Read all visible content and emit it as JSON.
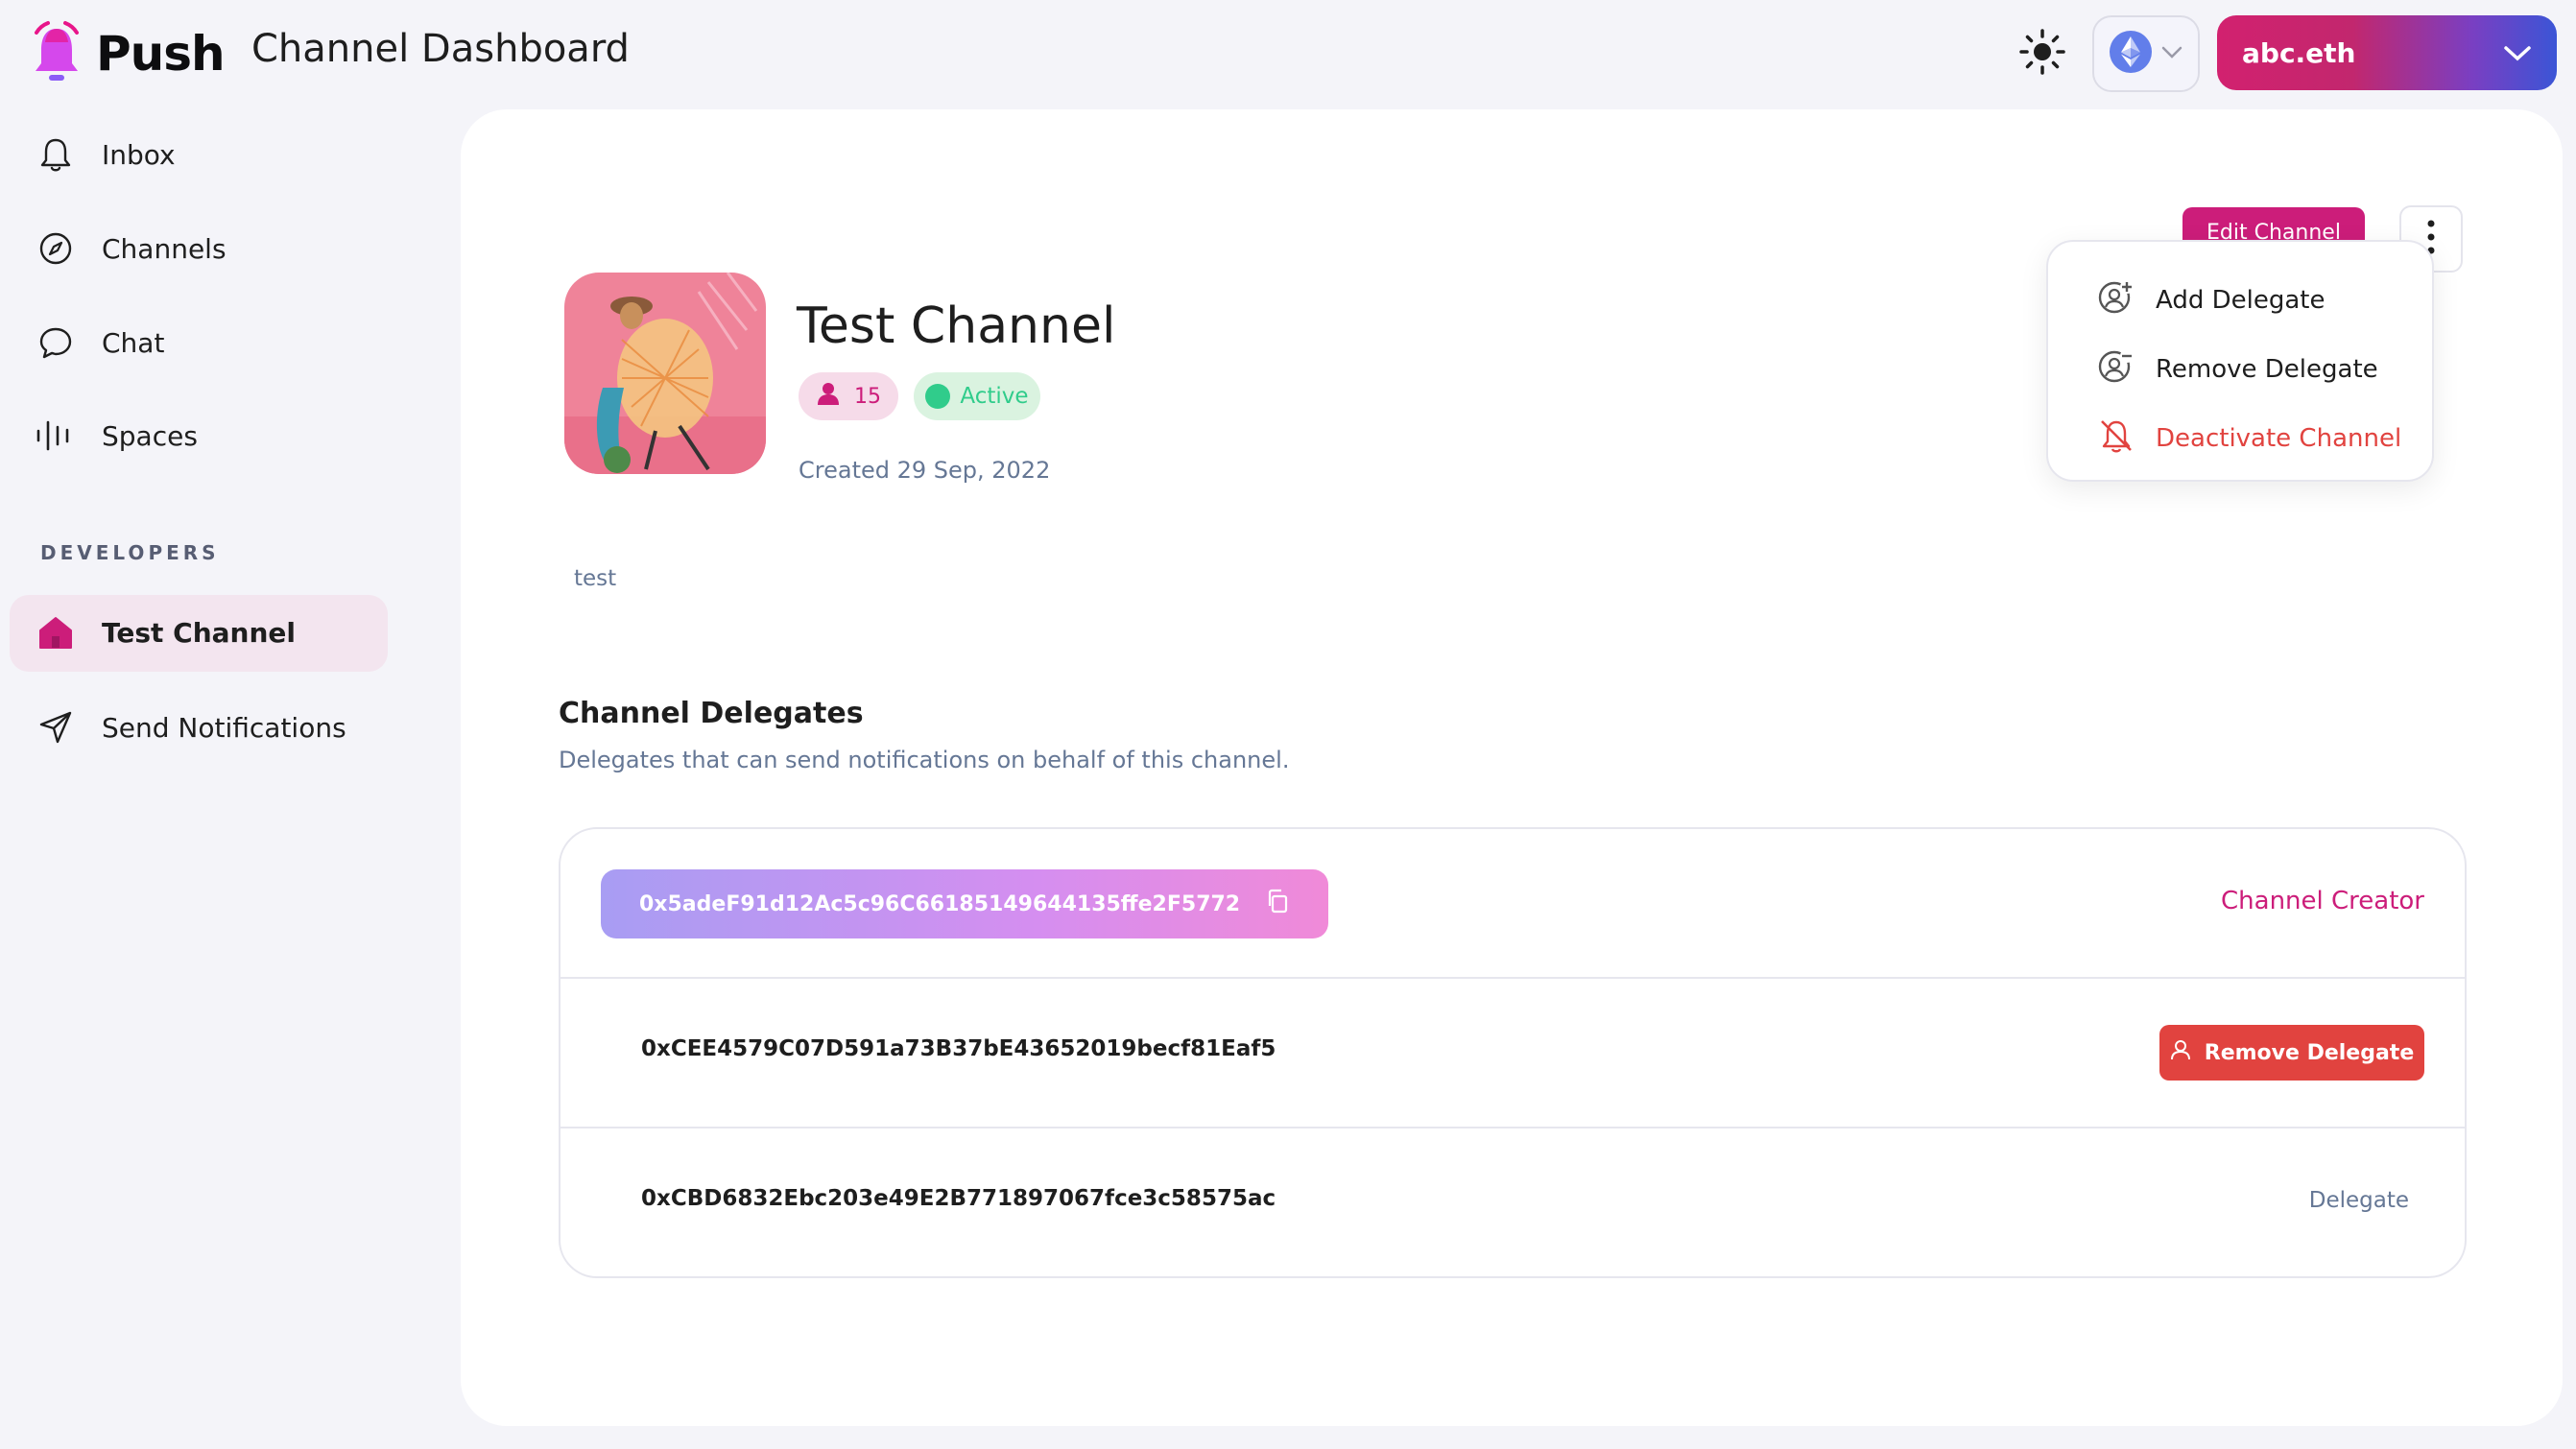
{
  "header": {
    "logo_text": "Push",
    "title": "Channel Dashboard",
    "account_label": "abc.eth",
    "network_icon": "ethereum-icon",
    "theme_icon": "sun-icon"
  },
  "sidebar": {
    "items": [
      {
        "label": "Inbox",
        "icon": "bell-icon"
      },
      {
        "label": "Channels",
        "icon": "compass-icon"
      },
      {
        "label": "Chat",
        "icon": "chat-bubble-icon"
      },
      {
        "label": "Spaces",
        "icon": "audio-bars-icon"
      }
    ],
    "section_label": "DEVELOPERS",
    "dev_items": [
      {
        "label": "Test Channel",
        "icon": "home-icon",
        "active": true
      },
      {
        "label": "Send Notifications",
        "icon": "send-icon"
      }
    ]
  },
  "channel": {
    "edit_label": "Edit Channel",
    "name": "Test Channel",
    "subscribers": "15",
    "status": "Active",
    "created": "Created 29 Sep, 2022",
    "description": "test"
  },
  "delegates": {
    "title": "Channel Delegates",
    "subtitle": "Delegates that can send notifications on behalf of this channel.",
    "rows": [
      {
        "address": "0x5adeF91d12Ac5c96C66185149644135ffe2F5772",
        "role": "Channel Creator"
      },
      {
        "address": "0xCEE4579C07D591a73B37bE43652019becf81Eaf5",
        "action": "Remove Delegate"
      },
      {
        "address": "0xCBD6832Ebc203e49E2B771897067fce3c58575ac",
        "role": "Delegate"
      }
    ]
  },
  "menu": {
    "items": [
      {
        "label": "Add Delegate",
        "icon": "add-user-icon"
      },
      {
        "label": "Remove Delegate",
        "icon": "remove-user-icon"
      },
      {
        "label": "Deactivate Channel",
        "icon": "bell-off-icon"
      }
    ]
  },
  "colors": {
    "brand_pink": "#cc1d7a",
    "danger_red": "#e1433f",
    "active_green": "#30cc8b",
    "muted_text": "#657795"
  }
}
